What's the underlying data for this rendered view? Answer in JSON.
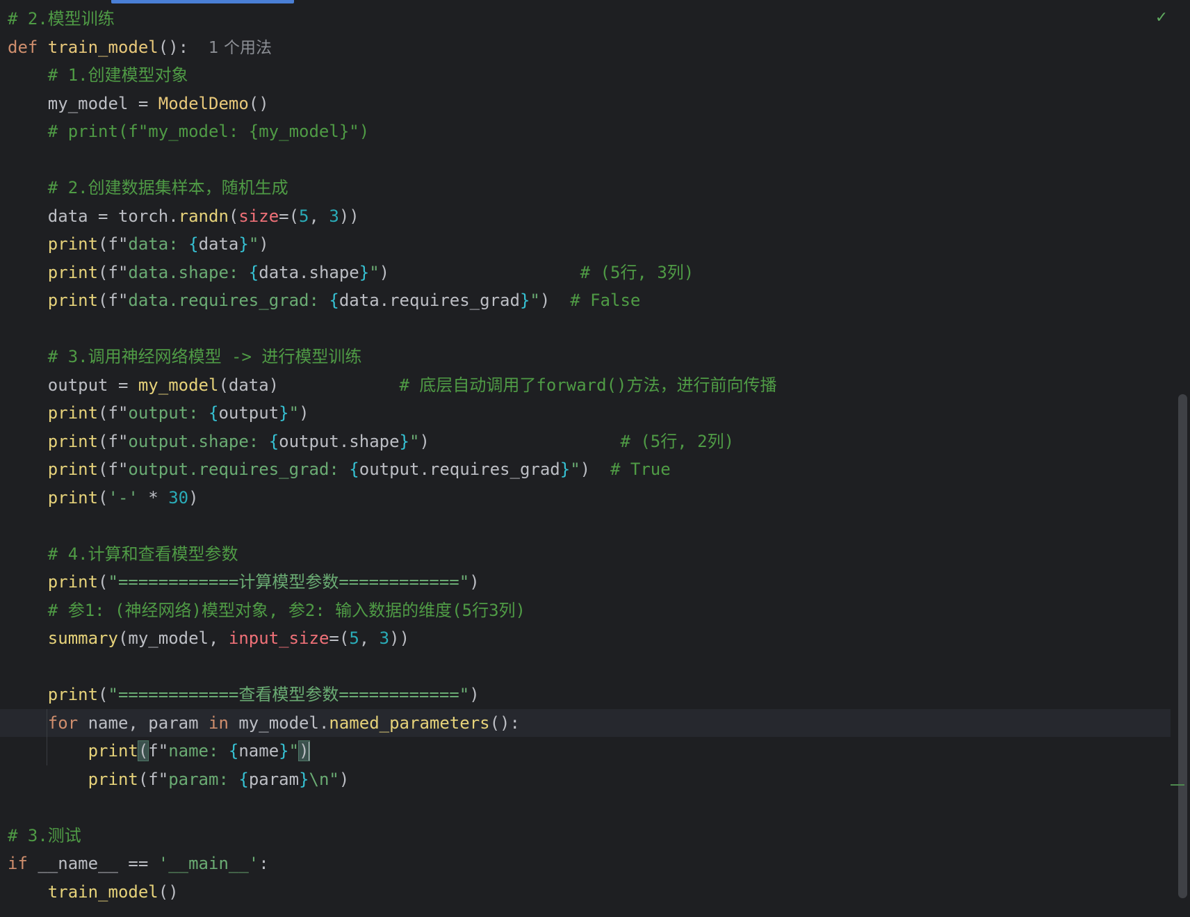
{
  "editor": {
    "language": "python",
    "status_icon": "check-icon",
    "status_glyph": "✓",
    "lines": [
      [
        {
          "t": "cmt",
          "v": "# 2.模型训练"
        }
      ],
      [
        {
          "t": "kw",
          "v": "def "
        },
        {
          "t": "fn",
          "v": "train_model"
        },
        {
          "t": "plain",
          "v": "():  "
        },
        {
          "t": "hint",
          "v": "1 个用法"
        }
      ],
      [
        {
          "t": "plain",
          "v": "    "
        },
        {
          "t": "cmt",
          "v": "# 1.创建模型对象"
        }
      ],
      [
        {
          "t": "plain",
          "v": "    my_model = "
        },
        {
          "t": "cls",
          "v": "ModelDemo"
        },
        {
          "t": "plain",
          "v": "()"
        }
      ],
      [
        {
          "t": "plain",
          "v": "    "
        },
        {
          "t": "cmt",
          "v": "# print(f\"my_model: {my_model}\")"
        }
      ],
      [],
      [
        {
          "t": "plain",
          "v": "    "
        },
        {
          "t": "cmt",
          "v": "# 2.创建数据集样本，随机生成"
        }
      ],
      [
        {
          "t": "plain",
          "v": "    data = torch."
        },
        {
          "t": "call",
          "v": "randn"
        },
        {
          "t": "plain",
          "v": "("
        },
        {
          "t": "param",
          "v": "size"
        },
        {
          "t": "plain",
          "v": "=("
        },
        {
          "t": "num",
          "v": "5"
        },
        {
          "t": "plain",
          "v": ", "
        },
        {
          "t": "num",
          "v": "3"
        },
        {
          "t": "plain",
          "v": "))"
        }
      ],
      [
        {
          "t": "plain",
          "v": "    "
        },
        {
          "t": "call",
          "v": "print"
        },
        {
          "t": "plain",
          "v": "(f\""
        },
        {
          "t": "str",
          "v": "data: "
        },
        {
          "t": "brace",
          "v": "{"
        },
        {
          "t": "plain",
          "v": "data"
        },
        {
          "t": "brace",
          "v": "}"
        },
        {
          "t": "str",
          "v": "\""
        },
        {
          "t": "plain",
          "v": ")"
        }
      ],
      [
        {
          "t": "plain",
          "v": "    "
        },
        {
          "t": "call",
          "v": "print"
        },
        {
          "t": "plain",
          "v": "(f\""
        },
        {
          "t": "str",
          "v": "data.shape: "
        },
        {
          "t": "brace",
          "v": "{"
        },
        {
          "t": "plain",
          "v": "data.shape"
        },
        {
          "t": "brace",
          "v": "}"
        },
        {
          "t": "str",
          "v": "\""
        },
        {
          "t": "plain",
          "v": ")                   "
        },
        {
          "t": "cmt",
          "v": "# (5行, 3列)"
        }
      ],
      [
        {
          "t": "plain",
          "v": "    "
        },
        {
          "t": "call",
          "v": "print"
        },
        {
          "t": "plain",
          "v": "(f\""
        },
        {
          "t": "str",
          "v": "data.requires_grad: "
        },
        {
          "t": "brace",
          "v": "{"
        },
        {
          "t": "plain",
          "v": "data.requires_grad"
        },
        {
          "t": "brace",
          "v": "}"
        },
        {
          "t": "str",
          "v": "\""
        },
        {
          "t": "plain",
          "v": ")  "
        },
        {
          "t": "cmt",
          "v": "# False"
        }
      ],
      [],
      [
        {
          "t": "plain",
          "v": "    "
        },
        {
          "t": "cmt",
          "v": "# 3.调用神经网络模型 -> 进行模型训练"
        }
      ],
      [
        {
          "t": "plain",
          "v": "    output = "
        },
        {
          "t": "call",
          "v": "my_model"
        },
        {
          "t": "plain",
          "v": "(data)            "
        },
        {
          "t": "cmt",
          "v": "# 底层自动调用了forward()方法，进行前向传播"
        }
      ],
      [
        {
          "t": "plain",
          "v": "    "
        },
        {
          "t": "call",
          "v": "print"
        },
        {
          "t": "plain",
          "v": "(f\""
        },
        {
          "t": "str",
          "v": "output: "
        },
        {
          "t": "brace",
          "v": "{"
        },
        {
          "t": "plain",
          "v": "output"
        },
        {
          "t": "brace",
          "v": "}"
        },
        {
          "t": "str",
          "v": "\""
        },
        {
          "t": "plain",
          "v": ")"
        }
      ],
      [
        {
          "t": "plain",
          "v": "    "
        },
        {
          "t": "call",
          "v": "print"
        },
        {
          "t": "plain",
          "v": "(f\""
        },
        {
          "t": "str",
          "v": "output.shape: "
        },
        {
          "t": "brace",
          "v": "{"
        },
        {
          "t": "plain",
          "v": "output.shape"
        },
        {
          "t": "brace",
          "v": "}"
        },
        {
          "t": "str",
          "v": "\""
        },
        {
          "t": "plain",
          "v": ")                   "
        },
        {
          "t": "cmt",
          "v": "# (5行, 2列)"
        }
      ],
      [
        {
          "t": "plain",
          "v": "    "
        },
        {
          "t": "call",
          "v": "print"
        },
        {
          "t": "plain",
          "v": "(f\""
        },
        {
          "t": "str",
          "v": "output.requires_grad: "
        },
        {
          "t": "brace",
          "v": "{"
        },
        {
          "t": "plain",
          "v": "output.requires_grad"
        },
        {
          "t": "brace",
          "v": "}"
        },
        {
          "t": "str",
          "v": "\""
        },
        {
          "t": "plain",
          "v": ")  "
        },
        {
          "t": "cmt",
          "v": "# True"
        }
      ],
      [
        {
          "t": "plain",
          "v": "    "
        },
        {
          "t": "call",
          "v": "print"
        },
        {
          "t": "plain",
          "v": "("
        },
        {
          "t": "str",
          "v": "'-'"
        },
        {
          "t": "plain",
          "v": " * "
        },
        {
          "t": "num",
          "v": "30"
        },
        {
          "t": "plain",
          "v": ")"
        }
      ],
      [],
      [
        {
          "t": "plain",
          "v": "    "
        },
        {
          "t": "cmt",
          "v": "# 4.计算和查看模型参数"
        }
      ],
      [
        {
          "t": "plain",
          "v": "    "
        },
        {
          "t": "call",
          "v": "print"
        },
        {
          "t": "plain",
          "v": "("
        },
        {
          "t": "str",
          "v": "\"============计算模型参数============\""
        },
        {
          "t": "plain",
          "v": ")"
        }
      ],
      [
        {
          "t": "plain",
          "v": "    "
        },
        {
          "t": "cmt",
          "v": "# 参1: (神经网络)模型对象, 参2: 输入数据的维度(5行3列)"
        }
      ],
      [
        {
          "t": "plain",
          "v": "    "
        },
        {
          "t": "call",
          "v": "summary"
        },
        {
          "t": "plain",
          "v": "(my_model, "
        },
        {
          "t": "param",
          "v": "input_size"
        },
        {
          "t": "plain",
          "v": "=("
        },
        {
          "t": "num",
          "v": "5"
        },
        {
          "t": "plain",
          "v": ", "
        },
        {
          "t": "num",
          "v": "3"
        },
        {
          "t": "plain",
          "v": "))"
        }
      ],
      [],
      [
        {
          "t": "plain",
          "v": "    "
        },
        {
          "t": "call",
          "v": "print"
        },
        {
          "t": "plain",
          "v": "("
        },
        {
          "t": "str",
          "v": "\"============查看模型参数============\""
        },
        {
          "t": "plain",
          "v": ")"
        }
      ],
      [
        {
          "t": "plain",
          "v": "    "
        },
        {
          "t": "kw",
          "v": "for"
        },
        {
          "t": "plain",
          "v": " name, param "
        },
        {
          "t": "kw",
          "v": "in"
        },
        {
          "t": "plain",
          "v": " my_model."
        },
        {
          "t": "call",
          "v": "named_parameters"
        },
        {
          "t": "plain",
          "v": "():"
        }
      ],
      [
        {
          "t": "plain",
          "v": "        "
        },
        {
          "t": "call",
          "v": "print"
        },
        {
          "t": "match",
          "v": "("
        },
        {
          "t": "plain",
          "v": "f\""
        },
        {
          "t": "str",
          "v": "name: "
        },
        {
          "t": "brace",
          "v": "{"
        },
        {
          "t": "plain",
          "v": "name"
        },
        {
          "t": "brace",
          "v": "}"
        },
        {
          "t": "str",
          "v": "\""
        },
        {
          "t": "match",
          "v": ")"
        },
        {
          "t": "caret",
          "v": ""
        }
      ],
      [
        {
          "t": "plain",
          "v": "        "
        },
        {
          "t": "call",
          "v": "print"
        },
        {
          "t": "plain",
          "v": "(f\""
        },
        {
          "t": "str",
          "v": "param: "
        },
        {
          "t": "brace",
          "v": "{"
        },
        {
          "t": "plain",
          "v": "param"
        },
        {
          "t": "brace",
          "v": "}"
        },
        {
          "t": "str",
          "v": "\\n\""
        },
        {
          "t": "plain",
          "v": ")"
        }
      ],
      [],
      [
        {
          "t": "cmt",
          "v": "# 3.测试"
        }
      ],
      [
        {
          "t": "kw",
          "v": "if"
        },
        {
          "t": "plain",
          "v": " __name__ == "
        },
        {
          "t": "str",
          "v": "'__main__'"
        },
        {
          "t": "plain",
          "v": ":"
        }
      ],
      [
        {
          "t": "plain",
          "v": "    "
        },
        {
          "t": "call",
          "v": "train_model"
        },
        {
          "t": "plain",
          "v": "()"
        }
      ]
    ],
    "current_line_index": 25
  }
}
